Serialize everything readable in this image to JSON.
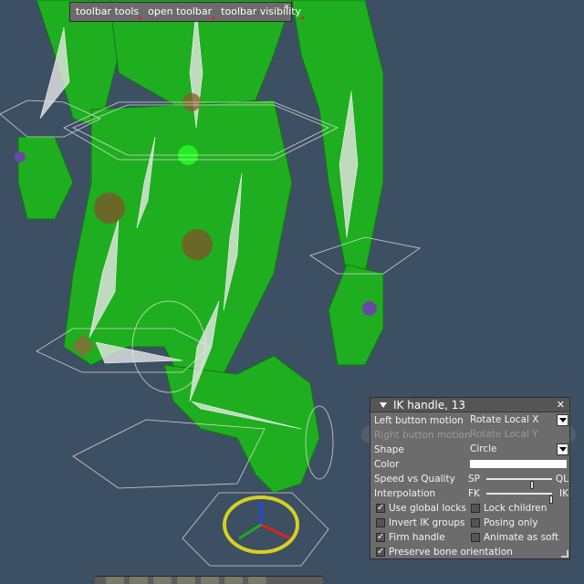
{
  "toolbar": {
    "items": [
      {
        "label": "toolbar tools"
      },
      {
        "label": "open toolbar"
      },
      {
        "label": "toolbar visibility"
      }
    ],
    "close_icon": "close-icon"
  },
  "panel": {
    "title": "IK handle, 13",
    "rows": {
      "left_motion": {
        "label": "Left button motion",
        "value": "Rotate Local X"
      },
      "right_motion": {
        "label": "Right button motion",
        "value": "Rotate Local Y"
      },
      "shape": {
        "label": "Shape",
        "value": "Circle"
      },
      "color": {
        "label": "Color",
        "value": "#ffffff"
      },
      "speed": {
        "label": "Speed vs Quality",
        "left": "SP",
        "right": "QL",
        "fraction": 0.7
      },
      "interp": {
        "label": "Interpolation",
        "left": "FK",
        "right": "IK",
        "fraction": 0.98
      }
    },
    "checks": [
      {
        "label": "Use global locks",
        "checked": true
      },
      {
        "label": "Lock children",
        "checked": false
      },
      {
        "label": "Invert IK groups",
        "checked": false
      },
      {
        "label": "Posing only",
        "checked": false
      },
      {
        "label": "Firm handle",
        "checked": true
      },
      {
        "label": "Animate as soft",
        "checked": false
      },
      {
        "label": "Preserve bone orientation",
        "checked": true
      }
    ]
  },
  "colors": {
    "background": "#3d4f63",
    "model": "#1fb81f",
    "bones": "#d8d8d8",
    "joint_gold": "#c9a24a",
    "ik_ring": "#d6d021"
  }
}
